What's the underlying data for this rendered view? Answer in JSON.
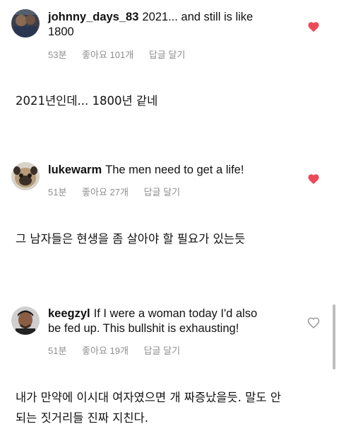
{
  "comments": [
    {
      "username": "johnny_days_83",
      "text_line1": "2021... and still is like",
      "text_line2": "1800",
      "time": "53분",
      "likes": "좋아요 101개",
      "reply": "답글 달기",
      "liked": true,
      "translation": "2021년인데... 1800년 같네"
    },
    {
      "username": "lukewarm",
      "text_line1": "The men need to get a life!",
      "time": "51분",
      "likes": "좋아요 27개",
      "reply": "답글 달기",
      "liked": true,
      "translation": "그 남자들은 현생을 좀 살아야 할 필요가 있는듯"
    },
    {
      "username": "keegzyl",
      "text_line1": "If I were a woman today I'd also",
      "text_line2": "be fed up. This bullshit is exhausting!",
      "time": "51분",
      "likes": "좋아요 19개",
      "reply": "답글 달기",
      "liked": false,
      "translation_line1": "내가 만약에 이시대 여자였으면 개 짜증났을듯. 말도 안",
      "translation_line2": "되는 짓거리들 진짜 지친다."
    }
  ],
  "colors": {
    "heart_liked": "#ed4956",
    "meta_gray": "#8e8e8e"
  }
}
